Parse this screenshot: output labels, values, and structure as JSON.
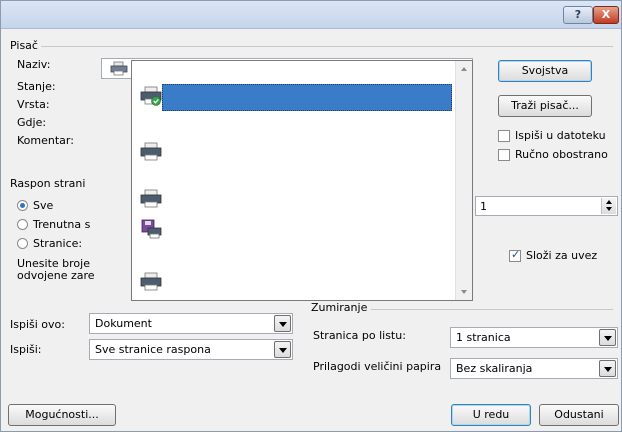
{
  "titlebar": {
    "help_glyph": "?",
    "close_glyph": "X"
  },
  "printer": {
    "group_label": "Pisač",
    "name_label": "Naziv:",
    "status_label": "Stanje:",
    "type_label": "Vrsta:",
    "where_label": "Gdje:",
    "comment_label": "Komentar:",
    "properties_button": "Svojstva",
    "find_button": "Traži pisač...",
    "print_to_file_label": "Ispiši u datoteku",
    "print_to_file_checked": false,
    "manual_duplex_label": "Ručno obostrano",
    "manual_duplex_checked": false
  },
  "range": {
    "group_label": "Raspon strani",
    "all_label": "Sve",
    "current_label": "Trenutna s",
    "pages_label": "Stranice:",
    "hint_line1": "Unesite broje",
    "hint_line2": "odvojene zare",
    "selected": "all"
  },
  "copies": {
    "value": "1",
    "collate_label": "Složi za uvez",
    "collate_checked": true
  },
  "zoom": {
    "group_label": "Zumiranje",
    "pages_per_sheet_label": "Stranica po listu:",
    "pages_per_sheet_value": "1 stranica",
    "scale_label": "Prilagodi veličini papira",
    "scale_value": "Bez skaliranja"
  },
  "print_what": {
    "label": "Ispiši ovo:",
    "value": "Dokument"
  },
  "print_option": {
    "label": "Ispiši:",
    "value": "Sve stranice raspona"
  },
  "footer": {
    "options_button": "Mogućnosti...",
    "ok_button": "U redu",
    "cancel_button": "Odustani"
  },
  "printer_list": {
    "items": [
      {
        "icon": "printer-small-icon"
      },
      {
        "icon": "printer-default-icon",
        "selected": true
      },
      {
        "icon": "printer-icon"
      },
      {
        "icon": "printer-icon"
      },
      {
        "icon": "printer-icon"
      },
      {
        "icon": "fax-disk-icon"
      },
      {
        "icon": "printer-icon"
      }
    ]
  }
}
